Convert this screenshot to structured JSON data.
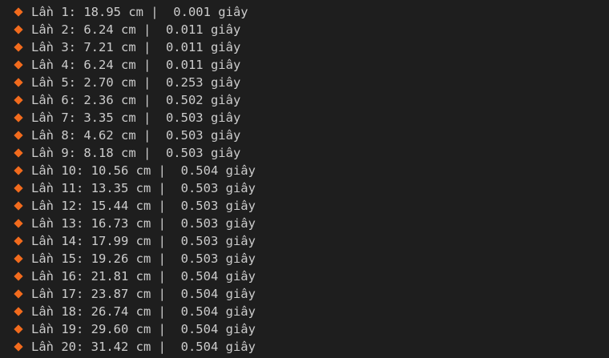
{
  "bullet_color": "#f26b1d",
  "bullet_icon": "orange-diamond-icon",
  "lines": [
    "Lần 1: 18.95 cm |  0.001 giây",
    "Lần 2: 6.24 cm |  0.011 giây",
    "Lần 3: 7.21 cm |  0.011 giây",
    "Lần 4: 6.24 cm |  0.011 giây",
    "Lần 5: 2.70 cm |  0.253 giây",
    "Lần 6: 2.36 cm |  0.502 giây",
    "Lần 7: 3.35 cm |  0.503 giây",
    "Lần 8: 4.62 cm |  0.503 giây",
    "Lần 9: 8.18 cm |  0.503 giây",
    "Lần 10: 10.56 cm |  0.504 giây",
    "Lần 11: 13.35 cm |  0.503 giây",
    "Lần 12: 15.44 cm |  0.503 giây",
    "Lần 13: 16.73 cm |  0.503 giây",
    "Lần 14: 17.99 cm |  0.503 giây",
    "Lần 15: 19.26 cm |  0.503 giây",
    "Lần 16: 21.81 cm |  0.504 giây",
    "Lần 17: 23.87 cm |  0.504 giây",
    "Lần 18: 26.74 cm |  0.504 giây",
    "Lần 19: 29.60 cm |  0.504 giây",
    "Lần 20: 31.42 cm |  0.504 giây"
  ]
}
